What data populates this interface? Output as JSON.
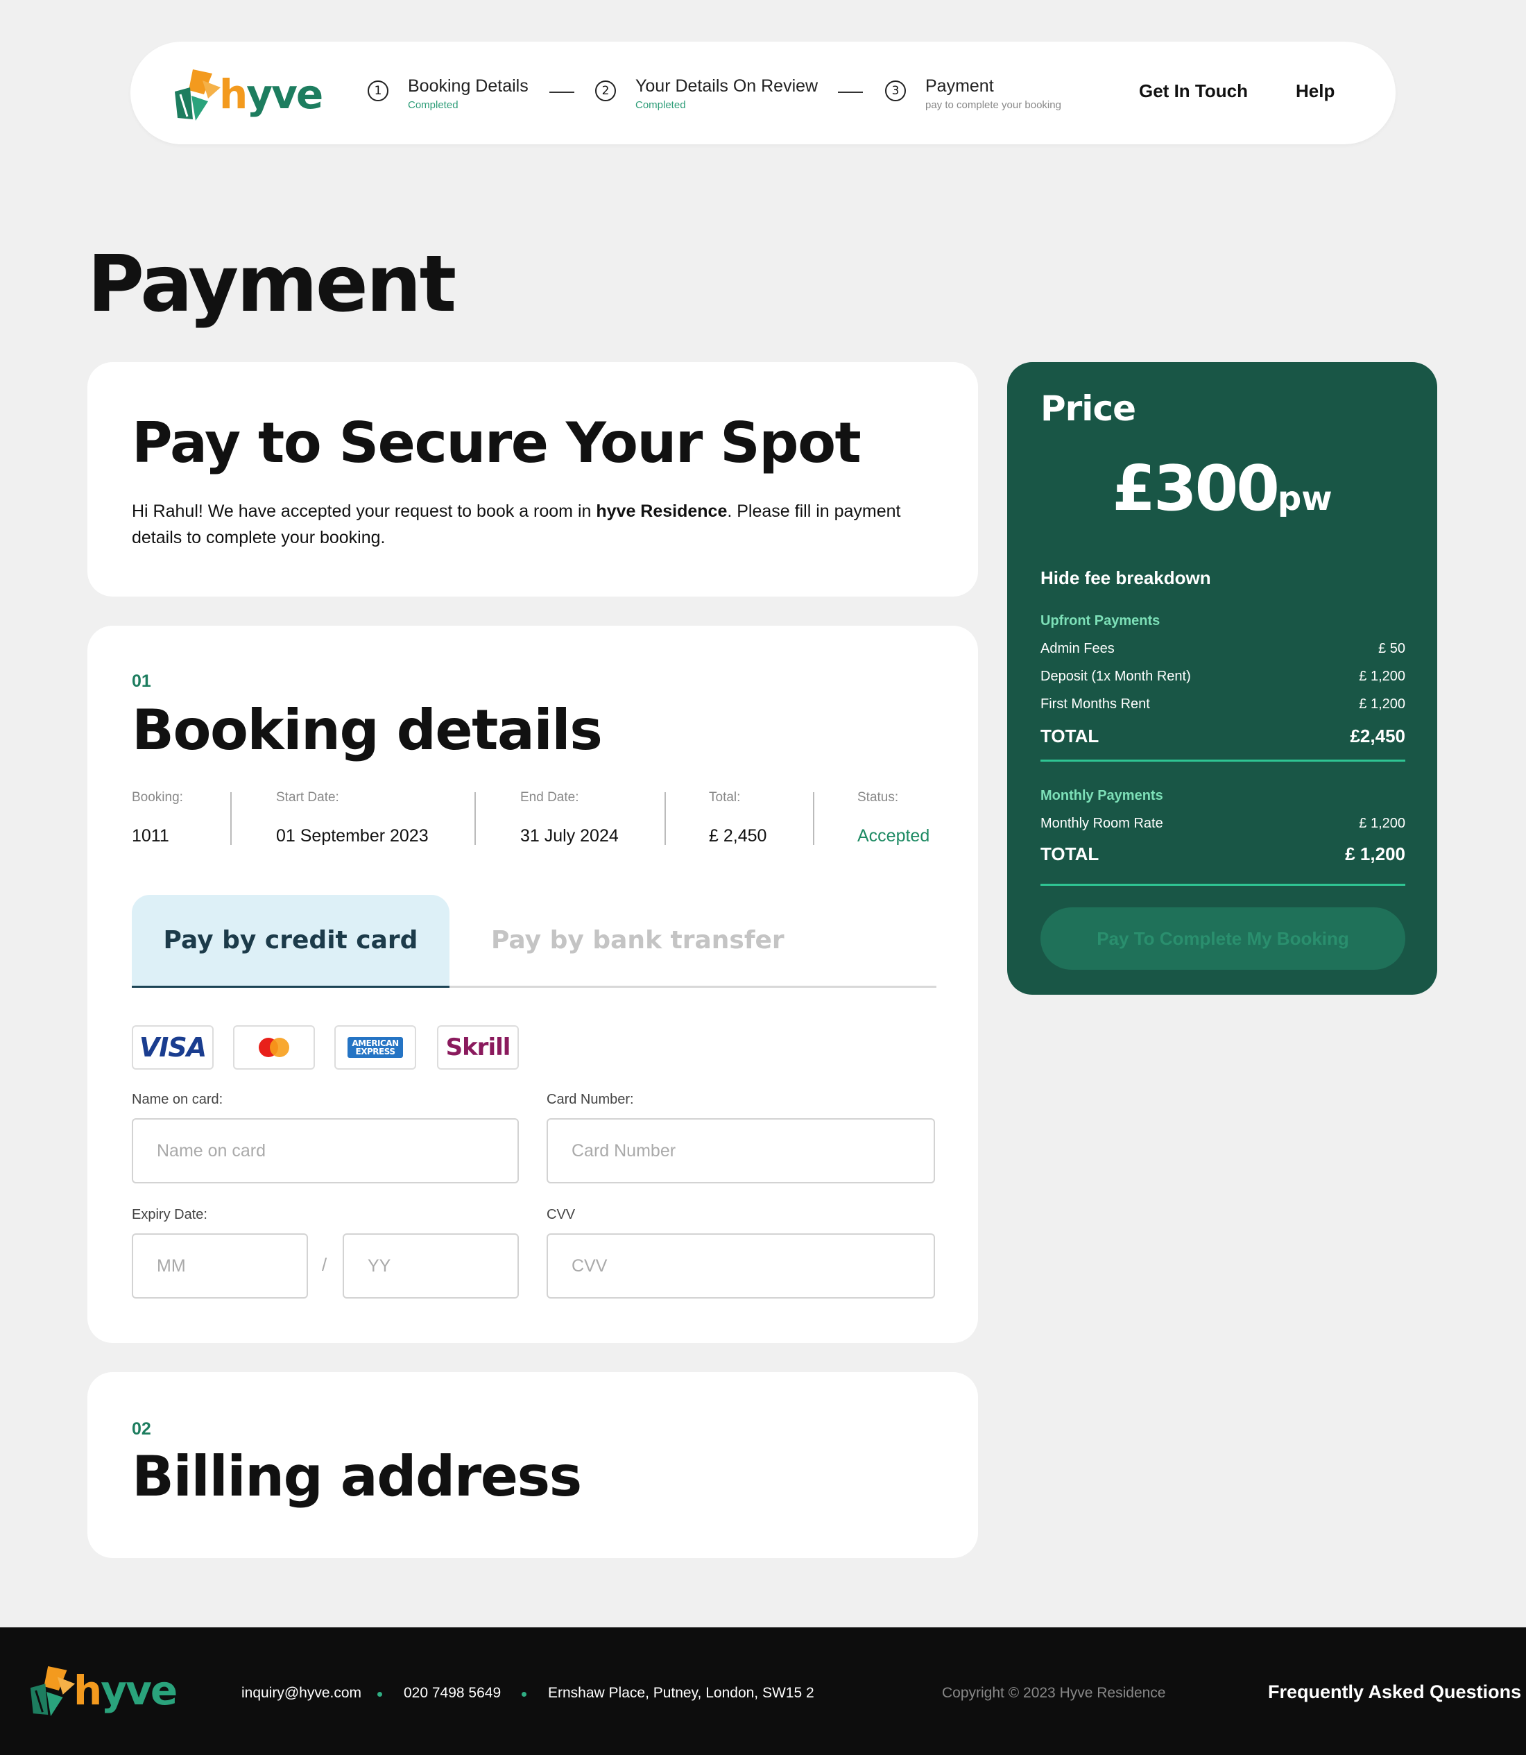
{
  "brand": {
    "name_h": "h",
    "name_rest": "yve"
  },
  "header": {
    "steps": [
      {
        "number": "1",
        "title": "Booking Details",
        "subtitle": "Completed"
      },
      {
        "number": "2",
        "title": "Your Details On Review",
        "subtitle": "Completed"
      },
      {
        "number": "3",
        "title": "Payment",
        "subtitle": "pay to complete your booking"
      }
    ],
    "links": [
      "Get In Touch",
      "Help"
    ]
  },
  "page_title": "Payment",
  "intro": {
    "heading": "Pay to Secure Your Spot",
    "text_before": "Hi Rahul! We have accepted your request to book a room in ",
    "residence": "hyve Residence",
    "text_after": ". Please fill in payment details to complete your booking."
  },
  "booking": {
    "section_number": "01",
    "heading": "Booking details",
    "details": [
      {
        "label": "Booking:",
        "value": "1011"
      },
      {
        "label": "Start Date:",
        "value": "01 September 2023"
      },
      {
        "label": "End Date:",
        "value": "31 July 2024"
      },
      {
        "label": "Total:",
        "value": "£ 2,450"
      },
      {
        "label": "Status:",
        "value": "Accepted"
      }
    ],
    "tabs": {
      "active": "Pay by credit card",
      "inactive": "Pay by bank transfer"
    },
    "card_logos": {
      "visa": "VISA",
      "mastercard": "mastercard-icon",
      "amex_line1": "AMERICAN",
      "amex_line2": "EXPRESS",
      "skrill": "Skrill"
    },
    "form": {
      "name_label": "Name on card:",
      "name_placeholder": "Name on card",
      "number_label": "Card Number:",
      "number_placeholder": "Card Number",
      "expiry_label": "Expiry Date:",
      "mm_placeholder": "MM",
      "slash": "/",
      "yy_placeholder": "YY",
      "cvv_label": "CVV",
      "cvv_placeholder": "CVV"
    }
  },
  "billing": {
    "section_number": "02",
    "heading": "Billing address"
  },
  "price": {
    "title": "Price",
    "amount": "£300",
    "unit": "pw",
    "toggle": "Hide fee breakdown",
    "upfront_title": "Upfront Payments",
    "upfront": [
      {
        "label": "Admin Fees",
        "value": "£ 50"
      },
      {
        "label": "Deposit (1x Month Rent)",
        "value": "£ 1,200"
      },
      {
        "label": "First Months Rent",
        "value": "£ 1,200"
      }
    ],
    "upfront_total_label": "TOTAL",
    "upfront_total": "£2,450",
    "monthly_title": "Monthly Payments",
    "monthly": [
      {
        "label": "Monthly Room Rate",
        "value": "£ 1,200"
      }
    ],
    "monthly_total_label": "TOTAL",
    "monthly_total": "£ 1,200",
    "button": "Pay To Complete My Booking"
  },
  "footer": {
    "email": "inquiry@hyve.com",
    "phone": "020 7498 5649",
    "address": "Ernshaw Place, Putney, London, SW15 2",
    "copyright": "Copyright © 2023 Hyve Residence",
    "faq": "Frequently Asked Questions"
  },
  "colors": {
    "brand_green": "#195646",
    "accent_orange": "#f39a1e",
    "accent_green": "#1d7d5f",
    "status_green": "#1d8a63"
  }
}
